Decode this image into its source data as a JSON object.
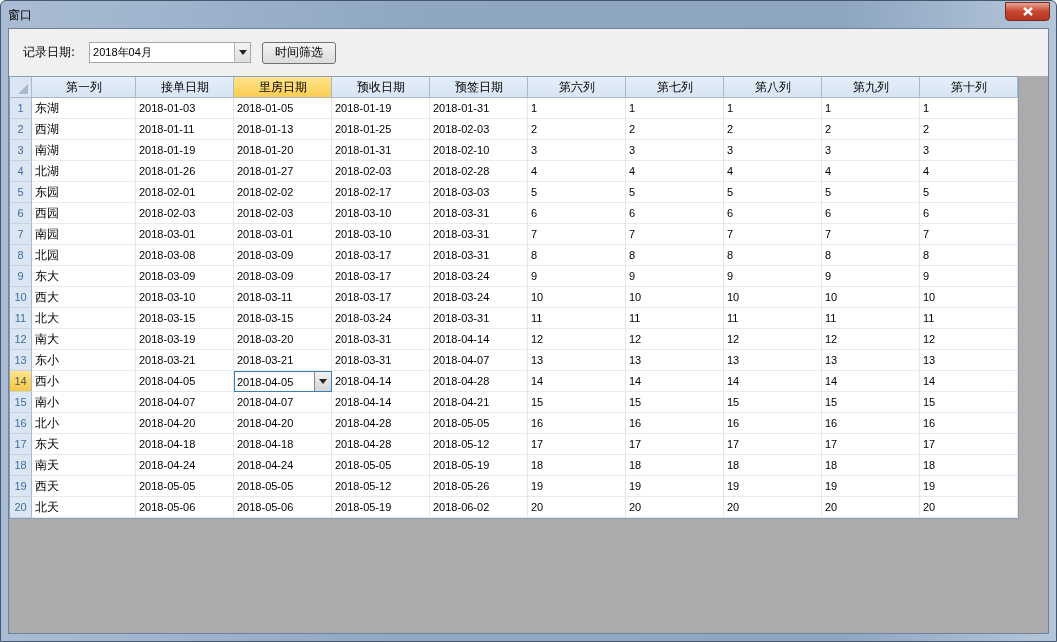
{
  "window": {
    "title": "窗口"
  },
  "toolbar": {
    "label": "记录日期:",
    "date_value": "2018年04月",
    "filter_button": "时间筛选"
  },
  "table": {
    "columns": [
      {
        "label": "第一列",
        "selected": false
      },
      {
        "label": "接单日期",
        "selected": false
      },
      {
        "label": "里房日期",
        "selected": true
      },
      {
        "label": "预收日期",
        "selected": false
      },
      {
        "label": "预签日期",
        "selected": false
      },
      {
        "label": "第六列",
        "selected": false
      },
      {
        "label": "第七列",
        "selected": false
      },
      {
        "label": "第八列",
        "selected": false
      },
      {
        "label": "第九列",
        "selected": false
      },
      {
        "label": "第十列",
        "selected": false
      }
    ],
    "rows": [
      {
        "number": "1",
        "selected": false,
        "editing": false,
        "cells": [
          "东湖",
          "2018-01-03",
          "2018-01-05",
          "2018-01-19",
          "2018-01-31",
          "1",
          "1",
          "1",
          "1",
          "1"
        ]
      },
      {
        "number": "2",
        "selected": false,
        "editing": false,
        "cells": [
          "西湖",
          "2018-01-11",
          "2018-01-13",
          "2018-01-25",
          "2018-02-03",
          "2",
          "2",
          "2",
          "2",
          "2"
        ]
      },
      {
        "number": "3",
        "selected": false,
        "editing": false,
        "cells": [
          "南湖",
          "2018-01-19",
          "2018-01-20",
          "2018-01-31",
          "2018-02-10",
          "3",
          "3",
          "3",
          "3",
          "3"
        ]
      },
      {
        "number": "4",
        "selected": false,
        "editing": false,
        "cells": [
          "北湖",
          "2018-01-26",
          "2018-01-27",
          "2018-02-03",
          "2018-02-28",
          "4",
          "4",
          "4",
          "4",
          "4"
        ]
      },
      {
        "number": "5",
        "selected": false,
        "editing": false,
        "cells": [
          "东园",
          "2018-02-01",
          "2018-02-02",
          "2018-02-17",
          "2018-03-03",
          "5",
          "5",
          "5",
          "5",
          "5"
        ]
      },
      {
        "number": "6",
        "selected": false,
        "editing": false,
        "cells": [
          "西园",
          "2018-02-03",
          "2018-02-03",
          "2018-03-10",
          "2018-03-31",
          "6",
          "6",
          "6",
          "6",
          "6"
        ]
      },
      {
        "number": "7",
        "selected": false,
        "editing": false,
        "cells": [
          "南园",
          "2018-03-01",
          "2018-03-01",
          "2018-03-10",
          "2018-03-31",
          "7",
          "7",
          "7",
          "7",
          "7"
        ]
      },
      {
        "number": "8",
        "selected": false,
        "editing": false,
        "cells": [
          "北园",
          "2018-03-08",
          "2018-03-09",
          "2018-03-17",
          "2018-03-31",
          "8",
          "8",
          "8",
          "8",
          "8"
        ]
      },
      {
        "number": "9",
        "selected": false,
        "editing": false,
        "cells": [
          "东大",
          "2018-03-09",
          "2018-03-09",
          "2018-03-17",
          "2018-03-24",
          "9",
          "9",
          "9",
          "9",
          "9"
        ]
      },
      {
        "number": "10",
        "selected": false,
        "editing": false,
        "cells": [
          "西大",
          "2018-03-10",
          "2018-03-11",
          "2018-03-17",
          "2018-03-24",
          "10",
          "10",
          "10",
          "10",
          "10"
        ]
      },
      {
        "number": "11",
        "selected": false,
        "editing": false,
        "cells": [
          "北大",
          "2018-03-15",
          "2018-03-15",
          "2018-03-24",
          "2018-03-31",
          "11",
          "11",
          "11",
          "11",
          "11"
        ]
      },
      {
        "number": "12",
        "selected": false,
        "editing": false,
        "cells": [
          "南大",
          "2018-03-19",
          "2018-03-20",
          "2018-03-31",
          "2018-04-14",
          "12",
          "12",
          "12",
          "12",
          "12"
        ]
      },
      {
        "number": "13",
        "selected": false,
        "editing": false,
        "cells": [
          "东小",
          "2018-03-21",
          "2018-03-21",
          "2018-03-31",
          "2018-04-07",
          "13",
          "13",
          "13",
          "13",
          "13"
        ]
      },
      {
        "number": "14",
        "selected": true,
        "editing": true,
        "cells": [
          "西小",
          "2018-04-05",
          "2018-04-05",
          "2018-04-14",
          "2018-04-28",
          "14",
          "14",
          "14",
          "14",
          "14"
        ]
      },
      {
        "number": "15",
        "selected": false,
        "editing": false,
        "cells": [
          "南小",
          "2018-04-07",
          "2018-04-07",
          "2018-04-14",
          "2018-04-21",
          "15",
          "15",
          "15",
          "15",
          "15"
        ]
      },
      {
        "number": "16",
        "selected": false,
        "editing": false,
        "cells": [
          "北小",
          "2018-04-20",
          "2018-04-20",
          "2018-04-28",
          "2018-05-05",
          "16",
          "16",
          "16",
          "16",
          "16"
        ]
      },
      {
        "number": "17",
        "selected": false,
        "editing": false,
        "cells": [
          "东天",
          "2018-04-18",
          "2018-04-18",
          "2018-04-28",
          "2018-05-12",
          "17",
          "17",
          "17",
          "17",
          "17"
        ]
      },
      {
        "number": "18",
        "selected": false,
        "editing": false,
        "cells": [
          "南天",
          "2018-04-24",
          "2018-04-24",
          "2018-05-05",
          "2018-05-19",
          "18",
          "18",
          "18",
          "18",
          "18"
        ]
      },
      {
        "number": "19",
        "selected": false,
        "editing": false,
        "cells": [
          "西天",
          "2018-05-05",
          "2018-05-05",
          "2018-05-12",
          "2018-05-26",
          "19",
          "19",
          "19",
          "19",
          "19"
        ]
      },
      {
        "number": "20",
        "selected": false,
        "editing": false,
        "cells": [
          "北天",
          "2018-05-06",
          "2018-05-06",
          "2018-05-19",
          "2018-06-02",
          "20",
          "20",
          "20",
          "20",
          "20"
        ]
      }
    ]
  }
}
